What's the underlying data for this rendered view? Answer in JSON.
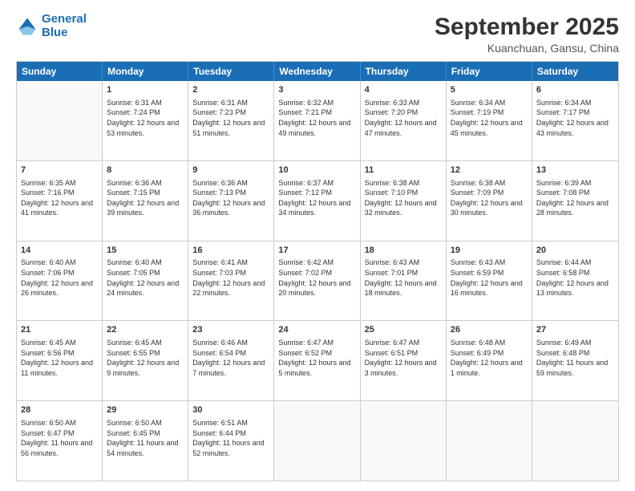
{
  "header": {
    "logo_line1": "General",
    "logo_line2": "Blue",
    "title": "September 2025",
    "subtitle": "Kuanchuan, Gansu, China"
  },
  "calendar": {
    "weekdays": [
      "Sunday",
      "Monday",
      "Tuesday",
      "Wednesday",
      "Thursday",
      "Friday",
      "Saturday"
    ],
    "rows": [
      [
        {
          "day": "",
          "empty": true
        },
        {
          "day": "1",
          "sunrise": "Sunrise: 6:31 AM",
          "sunset": "Sunset: 7:24 PM",
          "daylight": "Daylight: 12 hours and 53 minutes."
        },
        {
          "day": "2",
          "sunrise": "Sunrise: 6:31 AM",
          "sunset": "Sunset: 7:23 PM",
          "daylight": "Daylight: 12 hours and 51 minutes."
        },
        {
          "day": "3",
          "sunrise": "Sunrise: 6:32 AM",
          "sunset": "Sunset: 7:21 PM",
          "daylight": "Daylight: 12 hours and 49 minutes."
        },
        {
          "day": "4",
          "sunrise": "Sunrise: 6:33 AM",
          "sunset": "Sunset: 7:20 PM",
          "daylight": "Daylight: 12 hours and 47 minutes."
        },
        {
          "day": "5",
          "sunrise": "Sunrise: 6:34 AM",
          "sunset": "Sunset: 7:19 PM",
          "daylight": "Daylight: 12 hours and 45 minutes."
        },
        {
          "day": "6",
          "sunrise": "Sunrise: 6:34 AM",
          "sunset": "Sunset: 7:17 PM",
          "daylight": "Daylight: 12 hours and 43 minutes."
        }
      ],
      [
        {
          "day": "7",
          "sunrise": "Sunrise: 6:35 AM",
          "sunset": "Sunset: 7:16 PM",
          "daylight": "Daylight: 12 hours and 41 minutes."
        },
        {
          "day": "8",
          "sunrise": "Sunrise: 6:36 AM",
          "sunset": "Sunset: 7:15 PM",
          "daylight": "Daylight: 12 hours and 39 minutes."
        },
        {
          "day": "9",
          "sunrise": "Sunrise: 6:36 AM",
          "sunset": "Sunset: 7:13 PM",
          "daylight": "Daylight: 12 hours and 36 minutes."
        },
        {
          "day": "10",
          "sunrise": "Sunrise: 6:37 AM",
          "sunset": "Sunset: 7:12 PM",
          "daylight": "Daylight: 12 hours and 34 minutes."
        },
        {
          "day": "11",
          "sunrise": "Sunrise: 6:38 AM",
          "sunset": "Sunset: 7:10 PM",
          "daylight": "Daylight: 12 hours and 32 minutes."
        },
        {
          "day": "12",
          "sunrise": "Sunrise: 6:38 AM",
          "sunset": "Sunset: 7:09 PM",
          "daylight": "Daylight: 12 hours and 30 minutes."
        },
        {
          "day": "13",
          "sunrise": "Sunrise: 6:39 AM",
          "sunset": "Sunset: 7:08 PM",
          "daylight": "Daylight: 12 hours and 28 minutes."
        }
      ],
      [
        {
          "day": "14",
          "sunrise": "Sunrise: 6:40 AM",
          "sunset": "Sunset: 7:06 PM",
          "daylight": "Daylight: 12 hours and 26 minutes."
        },
        {
          "day": "15",
          "sunrise": "Sunrise: 6:40 AM",
          "sunset": "Sunset: 7:05 PM",
          "daylight": "Daylight: 12 hours and 24 minutes."
        },
        {
          "day": "16",
          "sunrise": "Sunrise: 6:41 AM",
          "sunset": "Sunset: 7:03 PM",
          "daylight": "Daylight: 12 hours and 22 minutes."
        },
        {
          "day": "17",
          "sunrise": "Sunrise: 6:42 AM",
          "sunset": "Sunset: 7:02 PM",
          "daylight": "Daylight: 12 hours and 20 minutes."
        },
        {
          "day": "18",
          "sunrise": "Sunrise: 6:43 AM",
          "sunset": "Sunset: 7:01 PM",
          "daylight": "Daylight: 12 hours and 18 minutes."
        },
        {
          "day": "19",
          "sunrise": "Sunrise: 6:43 AM",
          "sunset": "Sunset: 6:59 PM",
          "daylight": "Daylight: 12 hours and 16 minutes."
        },
        {
          "day": "20",
          "sunrise": "Sunrise: 6:44 AM",
          "sunset": "Sunset: 6:58 PM",
          "daylight": "Daylight: 12 hours and 13 minutes."
        }
      ],
      [
        {
          "day": "21",
          "sunrise": "Sunrise: 6:45 AM",
          "sunset": "Sunset: 6:56 PM",
          "daylight": "Daylight: 12 hours and 11 minutes."
        },
        {
          "day": "22",
          "sunrise": "Sunrise: 6:45 AM",
          "sunset": "Sunset: 6:55 PM",
          "daylight": "Daylight: 12 hours and 9 minutes."
        },
        {
          "day": "23",
          "sunrise": "Sunrise: 6:46 AM",
          "sunset": "Sunset: 6:54 PM",
          "daylight": "Daylight: 12 hours and 7 minutes."
        },
        {
          "day": "24",
          "sunrise": "Sunrise: 6:47 AM",
          "sunset": "Sunset: 6:52 PM",
          "daylight": "Daylight: 12 hours and 5 minutes."
        },
        {
          "day": "25",
          "sunrise": "Sunrise: 6:47 AM",
          "sunset": "Sunset: 6:51 PM",
          "daylight": "Daylight: 12 hours and 3 minutes."
        },
        {
          "day": "26",
          "sunrise": "Sunrise: 6:48 AM",
          "sunset": "Sunset: 6:49 PM",
          "daylight": "Daylight: 12 hours and 1 minute."
        },
        {
          "day": "27",
          "sunrise": "Sunrise: 6:49 AM",
          "sunset": "Sunset: 6:48 PM",
          "daylight": "Daylight: 11 hours and 59 minutes."
        }
      ],
      [
        {
          "day": "28",
          "sunrise": "Sunrise: 6:50 AM",
          "sunset": "Sunset: 6:47 PM",
          "daylight": "Daylight: 11 hours and 56 minutes."
        },
        {
          "day": "29",
          "sunrise": "Sunrise: 6:50 AM",
          "sunset": "Sunset: 6:45 PM",
          "daylight": "Daylight: 11 hours and 54 minutes."
        },
        {
          "day": "30",
          "sunrise": "Sunrise: 6:51 AM",
          "sunset": "Sunset: 6:44 PM",
          "daylight": "Daylight: 11 hours and 52 minutes."
        },
        {
          "day": "",
          "empty": true
        },
        {
          "day": "",
          "empty": true
        },
        {
          "day": "",
          "empty": true
        },
        {
          "day": "",
          "empty": true
        }
      ]
    ]
  }
}
